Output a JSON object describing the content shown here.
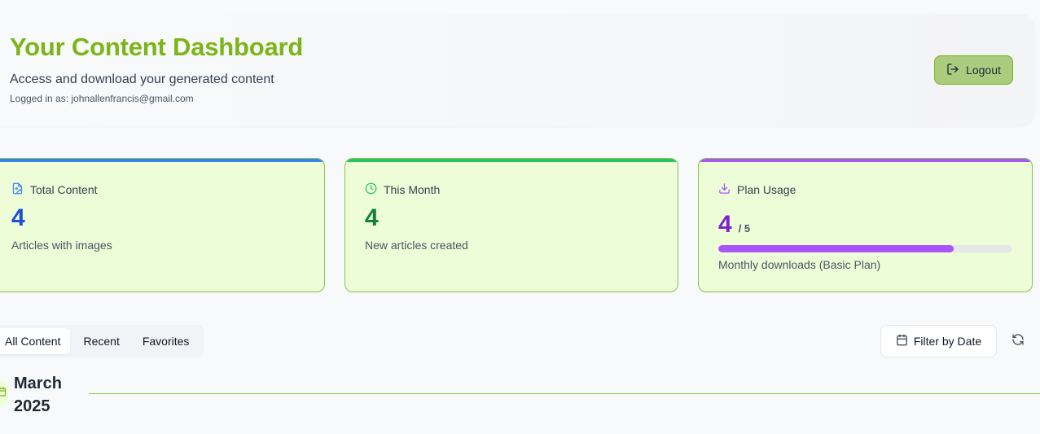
{
  "header": {
    "title": "Your Content Dashboard",
    "subtitle": "Access and download your generated content",
    "logged_in": "Logged in as: johnallenfrancis@gmail.com",
    "logout_label": "Logout"
  },
  "stats": {
    "total_content": {
      "label": "Total Content",
      "value": "4",
      "description": "Articles with images",
      "accent": "#3b82f6",
      "value_color": "#1d4ed8",
      "icon": "file-image-icon"
    },
    "this_month": {
      "label": "This Month",
      "value": "4",
      "description": "New articles created",
      "accent": "#22c55e",
      "value_color": "#15803d",
      "icon": "clock-icon"
    },
    "plan_usage": {
      "label": "Plan Usage",
      "value": "4",
      "limit": "/ 5",
      "usage_fraction": 0.8,
      "description": "Monthly downloads (Basic Plan)",
      "accent": "#a855f7",
      "value_color": "#7e22ce",
      "icon": "download-icon"
    }
  },
  "tabs": [
    {
      "label": "All Content",
      "active": true
    },
    {
      "label": "Recent",
      "active": false
    },
    {
      "label": "Favorites",
      "active": false
    }
  ],
  "toolbar": {
    "filter_label": "Filter by Date",
    "filter_icon": "calendar-icon",
    "refresh_icon": "refresh-icon"
  },
  "section": {
    "month_title": "March 2025",
    "icon": "calendar-icon"
  },
  "colors": {
    "brand": "#7cb518",
    "card_bg": "#ecfdd8",
    "card_border": "#8bc34a",
    "logout_bg": "#a9cc7e"
  }
}
